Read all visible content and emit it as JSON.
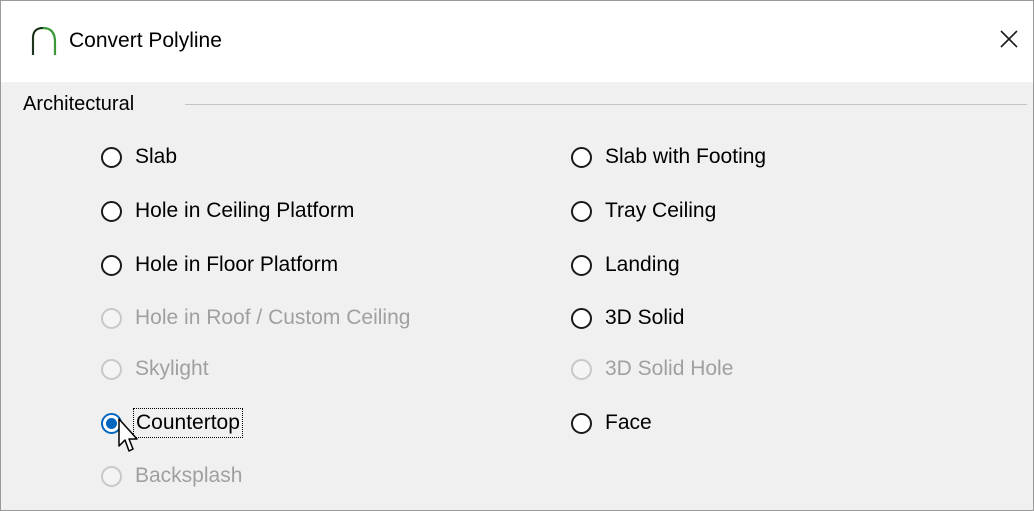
{
  "window": {
    "title": "Convert Polyline",
    "icon": "arc-icon",
    "close_icon": "close-icon"
  },
  "group": {
    "label": "Architectural"
  },
  "options_left": [
    {
      "label": "Slab",
      "state": "enabled",
      "checked": false
    },
    {
      "label": "Hole in Ceiling Platform",
      "state": "enabled",
      "checked": false
    },
    {
      "label": "Hole in Floor Platform",
      "state": "enabled",
      "checked": false
    },
    {
      "label": "Hole in Roof / Custom Ceiling",
      "state": "disabled",
      "checked": false
    },
    {
      "label": "Skylight",
      "state": "disabled",
      "checked": false
    },
    {
      "label": "Countertop",
      "state": "enabled",
      "checked": true,
      "focused": true
    },
    {
      "label": "Backsplash",
      "state": "disabled",
      "checked": false
    }
  ],
  "options_right": [
    {
      "label": "Slab with Footing",
      "state": "enabled",
      "checked": false
    },
    {
      "label": "Tray Ceiling",
      "state": "enabled",
      "checked": false
    },
    {
      "label": "Landing",
      "state": "enabled",
      "checked": false
    },
    {
      "label": "3D Solid",
      "state": "enabled",
      "checked": false
    },
    {
      "label": "3D Solid Hole",
      "state": "disabled",
      "checked": false
    },
    {
      "label": "Face",
      "state": "enabled",
      "checked": false
    }
  ],
  "colors": {
    "accent": "#0067c0",
    "disabled_text": "#a0a0a0",
    "dialog_bg": "#f0f0f0",
    "titlebar_bg": "#ffffff"
  }
}
